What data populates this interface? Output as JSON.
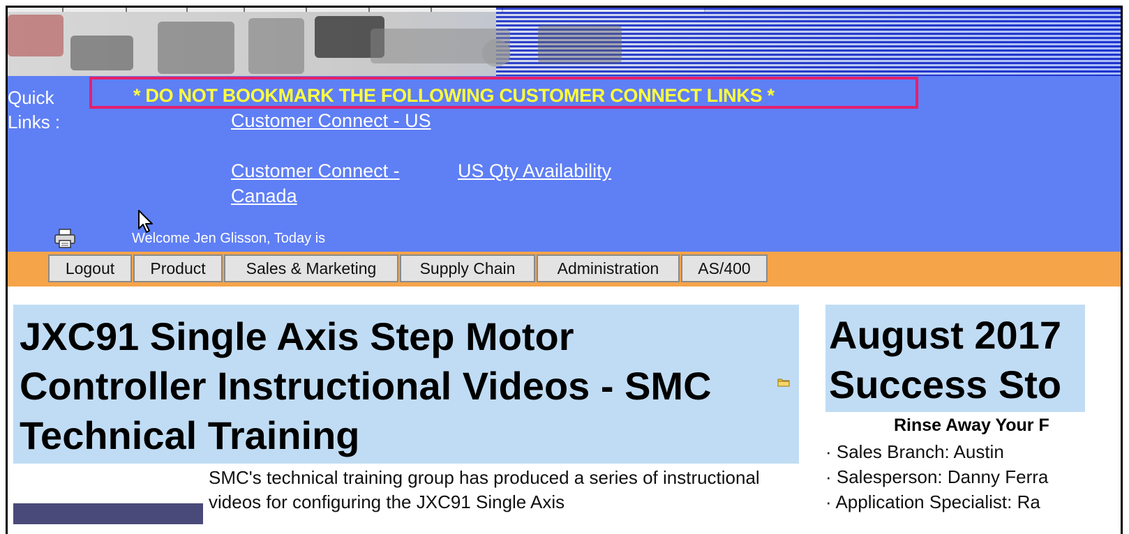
{
  "quick_links": {
    "label": "Quick Links :",
    "notice": "* DO NOT BOOKMARK THE FOLLOWING CUSTOMER CONNECT LINKS *",
    "links": [
      {
        "label": "Customer Connect - US"
      },
      {
        "label": "Customer Connect - Canada"
      },
      {
        "label": "US Qty Availability"
      }
    ]
  },
  "welcome_text": "Welcome Jen Glisson, Today is",
  "menu": {
    "items": [
      {
        "label": "Logout"
      },
      {
        "label": "Product"
      },
      {
        "label": "Sales & Marketing"
      },
      {
        "label": "Supply Chain"
      },
      {
        "label": "Administration"
      },
      {
        "label": "AS/400"
      }
    ]
  },
  "article": {
    "title": "JXC91 Single Axis Step Motor Controller Instructional Videos - SMC Technical Training",
    "body": "SMC's technical training group has produced a series of instructional videos for configuring the JXC91 Single Axis"
  },
  "sidebar": {
    "title": "August 2017 Success Sto",
    "subtitle": "Rinse Away Your F",
    "items": [
      {
        "text": "· Sales Branch: Austin"
      },
      {
        "text": "· Salesperson: Danny Ferra"
      },
      {
        "text": "· Application Specialist: Ra"
      }
    ]
  },
  "colors": {
    "quick_links_bg": "#5f7ff5",
    "notice_text": "#ffff3c",
    "notice_border": "#e5206b",
    "menu_bar_bg": "#f5a44a",
    "content_header_bg": "#c0dcf4"
  }
}
